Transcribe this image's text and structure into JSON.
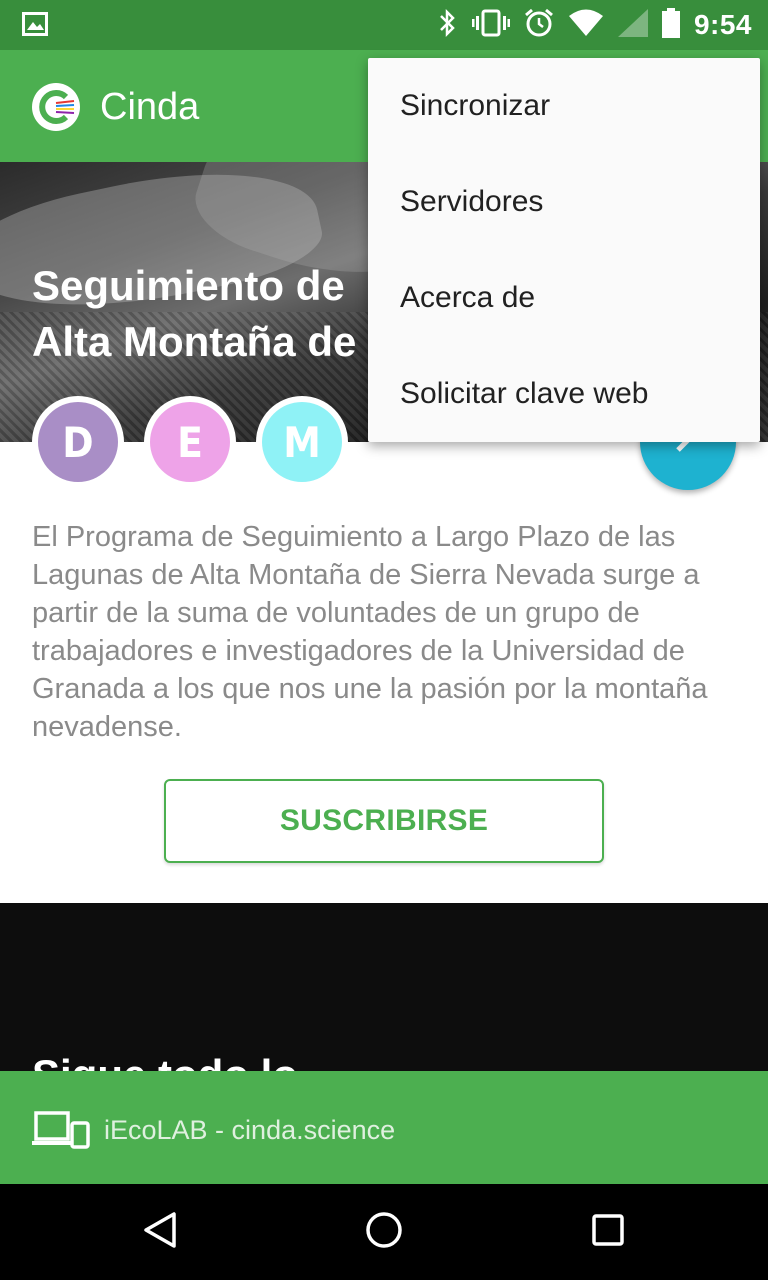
{
  "status_bar": {
    "time": "9:54",
    "icons": [
      "image-notification-icon",
      "bluetooth-icon",
      "vibrate-icon",
      "alarm-icon",
      "wifi-icon",
      "signal-icon",
      "battery-icon"
    ]
  },
  "app_bar": {
    "title": "Cinda",
    "logo": "cinda-logo-icon"
  },
  "hero": {
    "title_line1": "Seguimiento de",
    "title_line2": "Alta Montaña de"
  },
  "avatars": [
    {
      "letter": "D",
      "color": "#A98EC6"
    },
    {
      "letter": "E",
      "color": "#EEA3E8"
    },
    {
      "letter": "M",
      "color": "#8FF2F6"
    }
  ],
  "fab": {
    "icon": "edit-icon",
    "color": "#1EB2D0"
  },
  "description": "El Programa de Seguimiento a Largo Plazo de las Lagunas de Alta Montaña de Sierra Nevada surge a partir de la suma de voluntades de un grupo de trabajadores e investigadores de la Universidad de Granada a los que nos une la pasión por la montaña nevadense.",
  "subscribe_label": "SUSCRIBIRSE",
  "dark_section": {
    "title": "Sigue todo lo"
  },
  "footer": {
    "icon": "devices-icon",
    "text": "iEcoLAB - cinda.science"
  },
  "menu": {
    "items": [
      "Sincronizar",
      "Servidores",
      "Acerca de",
      "Solicitar clave web"
    ]
  },
  "nav": [
    "back-icon",
    "home-icon",
    "recents-icon"
  ],
  "colors": {
    "primary": "#4CAF50",
    "primary_dark": "#388E3C",
    "accent": "#1EB2D0"
  }
}
